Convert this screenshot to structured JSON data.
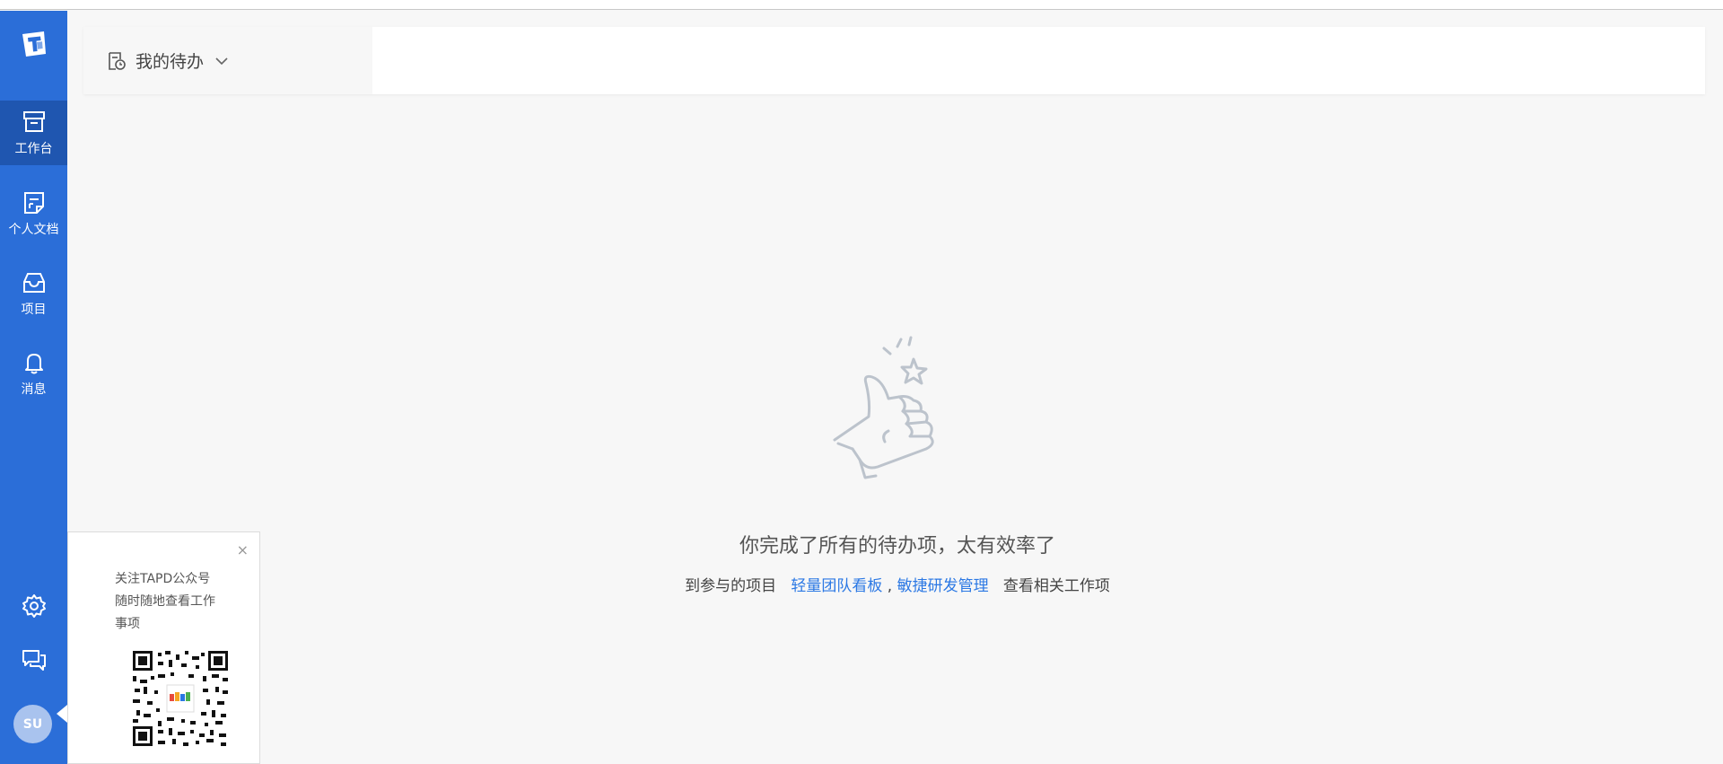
{
  "sidebar": {
    "items": [
      {
        "label": "工作台",
        "icon": "workbench-icon",
        "active": true
      },
      {
        "label": "个人文档",
        "icon": "personal-doc-icon",
        "active": false
      },
      {
        "label": "项目",
        "icon": "project-inbox-icon",
        "active": false
      },
      {
        "label": "消息",
        "icon": "bell-icon",
        "active": false
      }
    ],
    "bottom": {
      "settings_icon": "gear-icon",
      "feedback_icon": "chat-icon",
      "avatar_text": "SU"
    }
  },
  "header": {
    "todo_selector_label": "我的待办",
    "todo_icon": "calendar-clock-icon",
    "dropdown_icon": "chevron-down-icon"
  },
  "empty_state": {
    "illustration": "thumbs-up-star-icon",
    "title": "你完成了所有的待办项，太有效率了",
    "prefix": "到参与的项目",
    "link1": "轻量团队看板",
    "separator": ",",
    "link2": "敏捷研发管理",
    "suffix": "查看相关工作项"
  },
  "qr_popup": {
    "close": "×",
    "line1": "关注TAPD公众号",
    "line2": "随时随地查看工作",
    "line3": "事项",
    "qr_icon": "qr-code-icon"
  },
  "colors": {
    "sidebar": "#2b6ed8",
    "sidebar_active": "#1f56b0",
    "link": "#2b78e4",
    "background": "#f7f7f7"
  }
}
